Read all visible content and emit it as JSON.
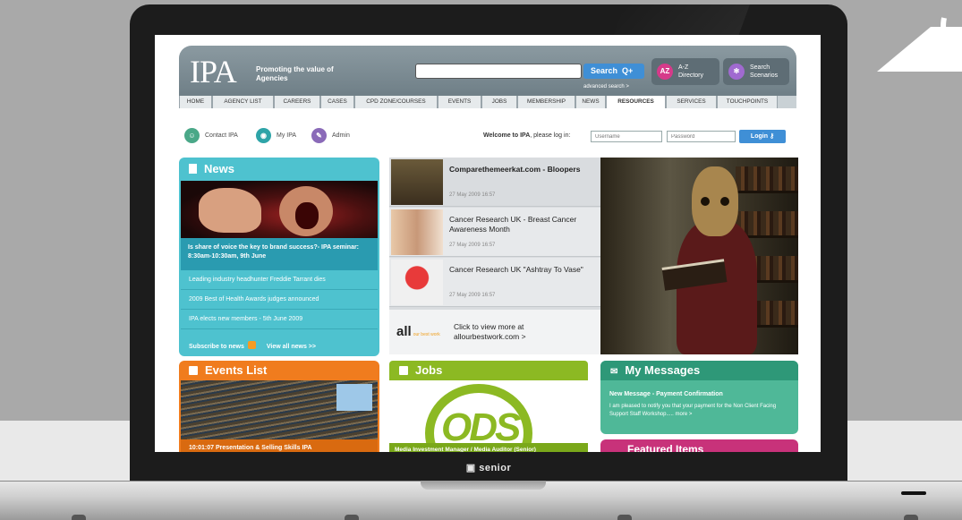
{
  "colors": {
    "header": "#7f8e95",
    "search_blue": "#3f8fd6",
    "news_teal": "#4ec2cf",
    "events_orange": "#f07c1e",
    "jobs_green": "#8cb923",
    "messages_green": "#4fb898",
    "featured_magenta": "#c8327a"
  },
  "device": {
    "brand": "senior"
  },
  "header": {
    "logo": "IPA",
    "tagline": "Promoting the value of Agencies",
    "search_button": "Search",
    "advanced_search": "advanced search >",
    "az_directory": {
      "icon": "AZ",
      "line1": "A-Z",
      "line2": "Directory"
    },
    "search_scenarios": {
      "line1": "Search",
      "line2": "Scenarios"
    }
  },
  "nav": {
    "tabs": [
      "HOME",
      "AGENCY LIST",
      "CAREERS",
      "CASES",
      "CPD ZONE/COURSES",
      "EVENTS",
      "JOBS",
      "MEMBERSHIP",
      "NEWS",
      "RESOURCES",
      "SERVICES",
      "TOUCHPOINTS"
    ],
    "active": "RESOURCES"
  },
  "userbar": {
    "contact": "Contact IPA",
    "my_ipa": "My IPA",
    "admin": "Admin",
    "welcome_bold": "Welcome to IPA",
    "welcome_rest": ", please log in:",
    "username_placeholder": "Username",
    "password_placeholder": "Password",
    "login_button": "Login"
  },
  "news": {
    "title": "News",
    "feature": "Is share of voice the key to brand success?- IPA seminar: 8:30am-10:30am, 9th June",
    "items": [
      "Leading industry headhunter Freddie Tarrant dies",
      "2009 Best of Health Awards judges announced",
      "IPA elects new members - 5th June 2009"
    ],
    "subscribe": "Subscribe to news",
    "view_all": "View all news >>"
  },
  "features": [
    {
      "title": "Comparethemeerkat.com - Bloopers",
      "date": "27 May 2009 16:57"
    },
    {
      "title": "Cancer Research UK - Breast Cancer Awareness Month",
      "date": "27 May 2009 16:57"
    },
    {
      "title": "Cancer Research UK \"Ashtray To Vase\"",
      "date": "27 May 2009 16:57"
    }
  ],
  "allour": {
    "logo": "all",
    "logo_small": "our best work",
    "line1": "Click to view more at",
    "line2": "allourbestwork.com >"
  },
  "events": {
    "title": "Events List",
    "strip": "10:01:07        Presentation & Selling Skills IPA"
  },
  "jobs": {
    "title": "Jobs",
    "logo_text": "ODS",
    "strip": "Media Investment Manager / Media Auditor (Senior)"
  },
  "messages": {
    "title": "My Messages",
    "message_title": "New Message - Payment Confirmation",
    "message_body": "I am pleased to notify you that your payment for the Non Client Facing Support Staff Workshop..... more >"
  },
  "featured": {
    "title": "Featured Items"
  }
}
